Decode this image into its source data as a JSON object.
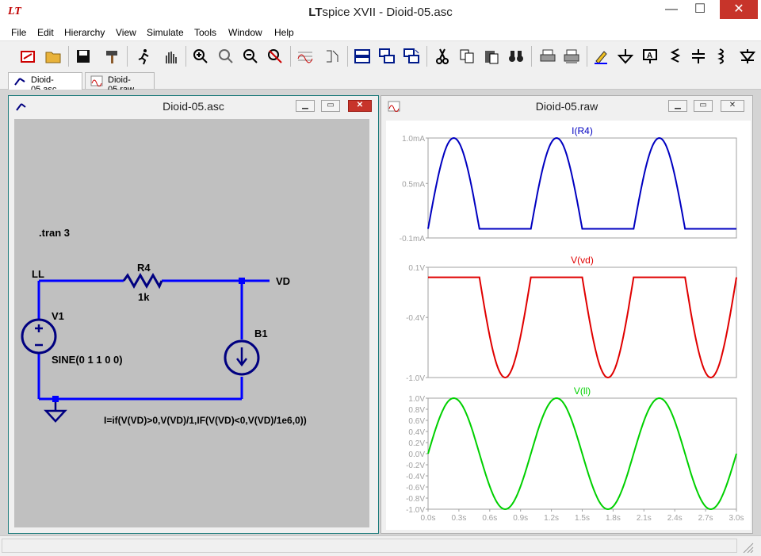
{
  "app": {
    "title_prefix": "LT",
    "title_rest": "spice XVII - Dioid-05.asc",
    "logo": "LT"
  },
  "window_controls": {
    "minimize": "—",
    "maximize": "☐",
    "close": "✕"
  },
  "menu": [
    "File",
    "Edit",
    "Hierarchy",
    "View",
    "Simulate",
    "Tools",
    "Window",
    "Help"
  ],
  "tabs": [
    {
      "label": "Dioid-05.asc",
      "icon": "schematic-icon"
    },
    {
      "label": "Dioid-05.raw",
      "icon": "waveform-icon"
    }
  ],
  "schematic_window": {
    "title": "Dioid-05.asc",
    "directive": ".tran 3",
    "resistor_name": "R4",
    "resistor_value": "1k",
    "source_name": "V1",
    "source_value": "SINE(0 1 1 0 0)",
    "bsource_name": "B1",
    "bsource_expr": "I=if(V(VD)>0,V(VD)/1,IF(V(VD)<0,V(VD)/1e6,0))",
    "net_left": "LL",
    "net_right": "VD",
    "colors": {
      "wire": "#0000ff",
      "component": "#000080",
      "text": "#000000",
      "background": "#c0c0c0"
    }
  },
  "waveform_window": {
    "title": "Dioid-05.raw",
    "x_ticks": [
      "0.0s",
      "0.3s",
      "0.6s",
      "0.9s",
      "1.2s",
      "1.5s",
      "1.8s",
      "2.1s",
      "2.4s",
      "2.7s",
      "3.0s"
    ]
  },
  "chart_data": [
    {
      "type": "line",
      "title": "I(R4)",
      "color": "#0000c0",
      "xlim": [
        0,
        3
      ],
      "ylim": [
        -0.1,
        1.0
      ],
      "y_ticks": [
        "1.0mA",
        "0.5mA",
        "-0.1mA"
      ],
      "y_tick_values": [
        1.0,
        0.5,
        -0.1
      ],
      "y_unit": "mA",
      "series": [
        {
          "x": [
            0,
            0.25,
            0.5,
            0.75,
            1.0,
            1.25,
            1.5,
            1.75,
            2.0,
            2.25,
            2.5,
            2.75,
            3.0
          ],
          "y": [
            0,
            1.0,
            0,
            0,
            0,
            1.0,
            0,
            0,
            0,
            1.0,
            0,
            0,
            0
          ]
        }
      ]
    },
    {
      "type": "line",
      "title": "V(vd)",
      "color": "#e00000",
      "xlim": [
        0,
        3
      ],
      "ylim": [
        -1.0,
        0.1
      ],
      "y_ticks": [
        "0.1V",
        "-0.4V",
        "-1.0V"
      ],
      "y_tick_values": [
        0.1,
        -0.4,
        -1.0
      ],
      "y_unit": "V",
      "series": [
        {
          "x": [
            0,
            0.25,
            0.5,
            0.75,
            1.0,
            1.25,
            1.5,
            1.75,
            2.0,
            2.25,
            2.5,
            2.75,
            3.0
          ],
          "y": [
            0,
            0,
            0,
            -1.0,
            0,
            0,
            0,
            -1.0,
            0,
            0,
            0,
            -1.0,
            0
          ]
        }
      ]
    },
    {
      "type": "line",
      "title": "V(ll)",
      "color": "#00d000",
      "xlim": [
        0,
        3
      ],
      "ylim": [
        -1.0,
        1.0
      ],
      "y_ticks": [
        "1.0V",
        "0.8V",
        "0.6V",
        "0.4V",
        "0.2V",
        "0.0V",
        "-0.2V",
        "-0.4V",
        "-0.6V",
        "-0.8V",
        "-1.0V"
      ],
      "y_tick_values": [
        1.0,
        0.8,
        0.6,
        0.4,
        0.2,
        0.0,
        -0.2,
        -0.4,
        -0.6,
        -0.8,
        -1.0
      ],
      "y_unit": "V",
      "series": [
        {
          "x": [
            0,
            0.25,
            0.5,
            0.75,
            1.0,
            1.25,
            1.5,
            1.75,
            2.0,
            2.25,
            2.5,
            2.75,
            3.0
          ],
          "y": [
            0,
            1.0,
            0,
            -1.0,
            0,
            1.0,
            0,
            -1.0,
            0,
            1.0,
            0,
            -1.0,
            0
          ]
        }
      ]
    }
  ]
}
